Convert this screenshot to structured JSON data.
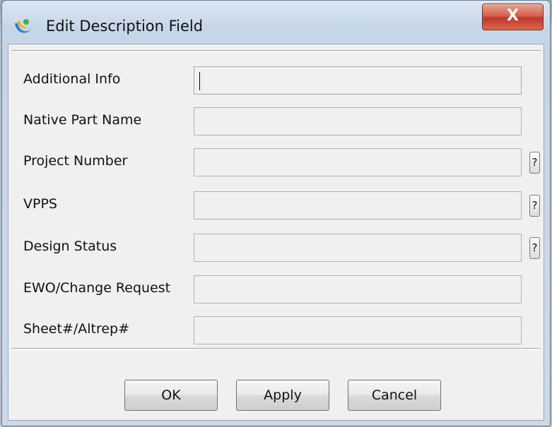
{
  "window": {
    "title": "Edit Description Field",
    "close_label": "X"
  },
  "fields": [
    {
      "label": "Additional Info",
      "value": "",
      "has_help": false,
      "focused": true
    },
    {
      "label": "Native Part Name",
      "value": "",
      "has_help": false,
      "focused": false
    },
    {
      "label": "Project Number",
      "value": "",
      "has_help": true,
      "focused": false
    },
    {
      "label": "VPPS",
      "value": "",
      "has_help": true,
      "focused": false
    },
    {
      "label": "Design Status",
      "value": "",
      "has_help": true,
      "focused": false
    },
    {
      "label": "EWO/Change Request",
      "value": "",
      "has_help": false,
      "focused": false
    },
    {
      "label": "Sheet#/Altrep#",
      "value": "",
      "has_help": false,
      "focused": false
    }
  ],
  "help_label": "?",
  "buttons": {
    "ok": "OK",
    "apply": "Apply",
    "cancel": "Cancel"
  },
  "icons": {
    "app": "app-logo-icon",
    "close": "close-icon"
  }
}
